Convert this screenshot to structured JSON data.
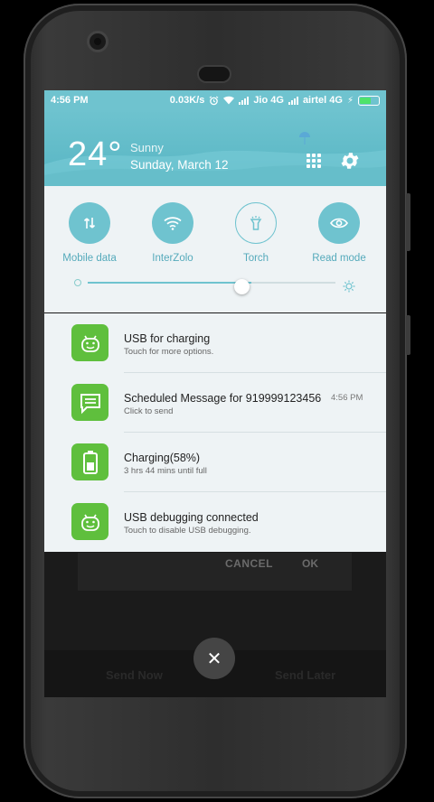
{
  "status_bar": {
    "time": "4:56 PM",
    "net_speed": "0.03K/s",
    "carrier1": "Jio 4G",
    "carrier2": "airtel 4G"
  },
  "weather": {
    "temperature": "24°",
    "condition": "Sunny",
    "date": "Sunday, March 12"
  },
  "quick_settings": {
    "tiles": [
      {
        "label": "Mobile data",
        "icon": "mobile-data-icon"
      },
      {
        "label": "InterZolo",
        "icon": "wifi-icon"
      },
      {
        "label": "Torch",
        "icon": "torch-icon"
      },
      {
        "label": "Read mode",
        "icon": "eye-icon"
      }
    ],
    "brightness_level": 0.66
  },
  "notifications": [
    {
      "title": "USB for charging",
      "subtitle": "Touch for more options.",
      "time": "",
      "icon": "android-icon"
    },
    {
      "title": "Scheduled Message for 919999123456",
      "subtitle": "Click to send",
      "time": "4:56 PM",
      "icon": "message-icon"
    },
    {
      "title": "Charging(58%)",
      "subtitle": "3 hrs 44 mins until full",
      "time": "",
      "icon": "battery-icon"
    },
    {
      "title": "USB debugging connected",
      "subtitle": "Touch to disable USB debugging.",
      "time": "",
      "icon": "android-icon"
    }
  ],
  "background_app": {
    "cancel": "CANCEL",
    "ok": "OK",
    "send_now": "Send Now",
    "send_later": "Send Later"
  },
  "close_glyph": "✕",
  "colors": {
    "accent": "#6fc3cf",
    "app_icon_green": "#5fbf3d",
    "panel_bg": "#eef3f5"
  }
}
